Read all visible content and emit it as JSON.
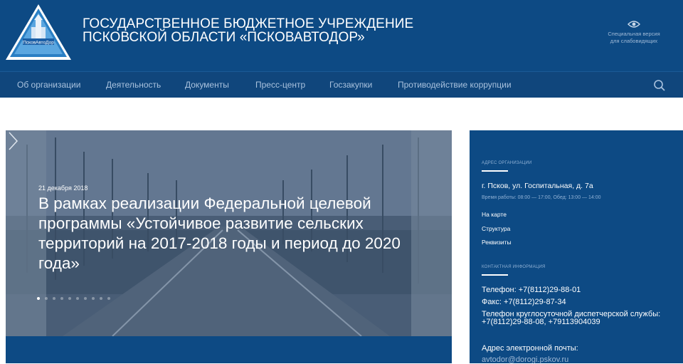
{
  "header": {
    "logo_text": "ПсковАвтоДор",
    "title_line1": "ГОСУДАРСТВЕННОЕ БЮДЖЕТНОЕ УЧРЕЖДЕНИЕ",
    "title_line2": "ПСКОВСКОЙ ОБЛАСТИ «ПСКОВАВТОДОР»",
    "accessibility_line1": "Специальная версия",
    "accessibility_line2": "для слабовидящих",
    "accessibility_icon": "eye-icon"
  },
  "nav": {
    "items": [
      {
        "label": "Об организации"
      },
      {
        "label": "Деятельность"
      },
      {
        "label": "Документы"
      },
      {
        "label": "Пресс-центр"
      },
      {
        "label": "Госзакупки"
      },
      {
        "label": "Противодействие коррупции"
      }
    ],
    "search_icon": "search-icon"
  },
  "slider": {
    "date": "21 декабря 2018",
    "title": "В рамках реализации Федеральной целевой программы «Устойчивое развитие сельских территорий на 2017-2018 годы и период до 2020 года»",
    "next_icon": "chevron-right-icon",
    "dots_total": 10,
    "active_dot": 0
  },
  "info": {
    "address_caption": "АДРЕС ОРГАНИЗАЦИИ",
    "address": "г. Псков, ул. Госпитальная, д. 7а",
    "hours": "Время работы: 08:00 — 17:00, Обед: 13:00 — 14:00",
    "links": [
      "На карте",
      "Структура",
      "Реквизиты"
    ],
    "contacts_caption": "КОНТАКТНАЯ ИНФОРМАЦИЯ",
    "phone": "Телефон: +7(8112)29-88-01",
    "fax": "Факс: +7(8112)29-87-34",
    "dispatch": "Телефон круглосуточной диспетчерской службы: +7(8112)29-88-08, +79113904039",
    "email_label": "Адрес электронной почты:",
    "email": "avtodor@dorogi.pskov.ru"
  },
  "colors": {
    "brand_blue": "#0d4a84",
    "nav_blue": "#10467c",
    "nav_text": "#a9c2de"
  }
}
